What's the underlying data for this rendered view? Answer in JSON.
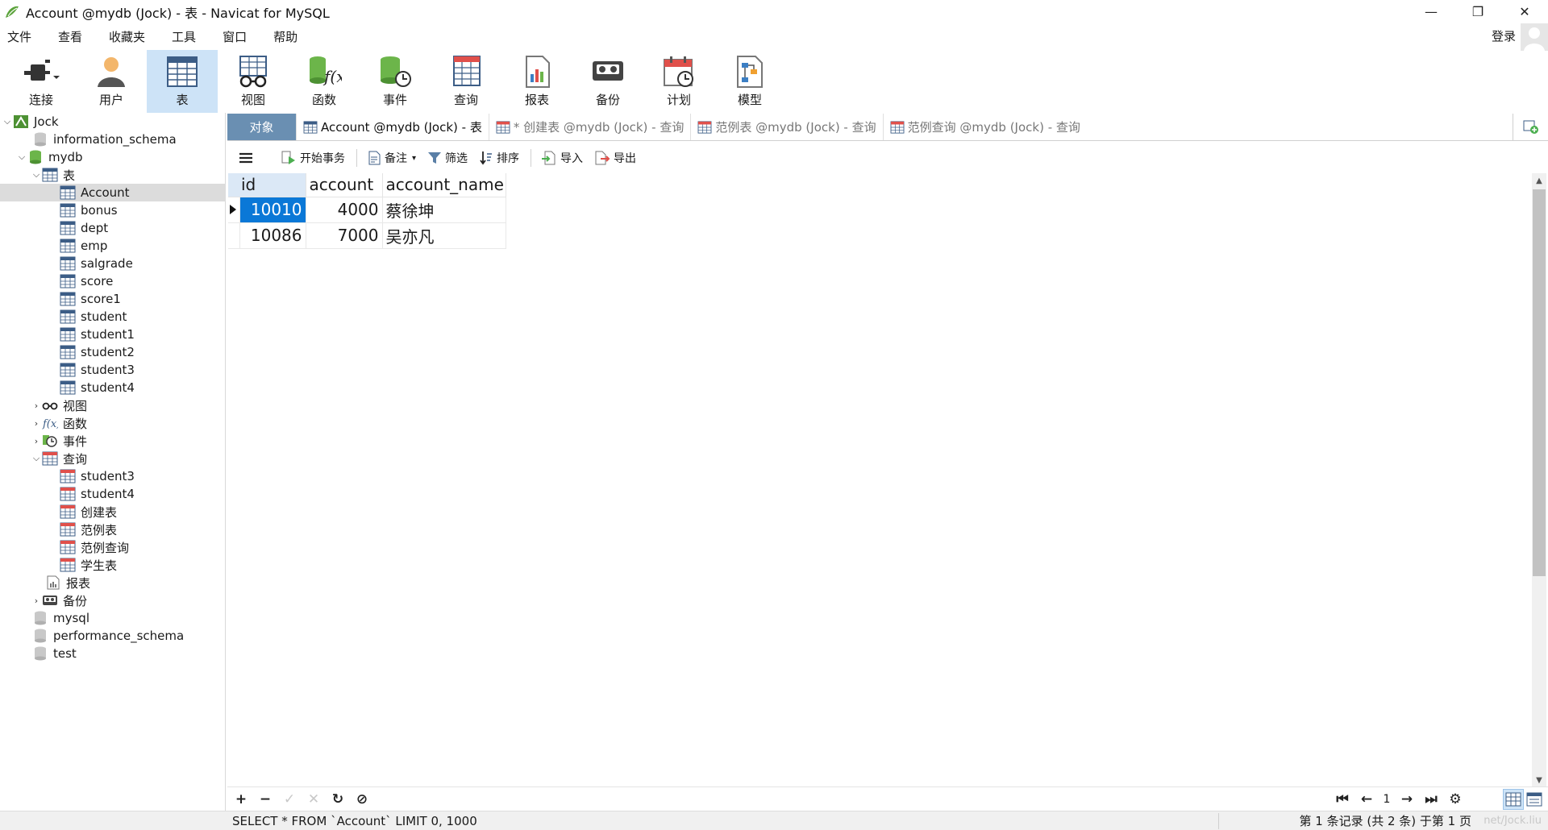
{
  "window": {
    "title": "Account @mydb (Jock) - 表 - Navicat for MySQL",
    "min": "—",
    "restore": "❐",
    "close": "✕"
  },
  "menu": [
    "文件",
    "查看",
    "收藏夹",
    "工具",
    "窗口",
    "帮助"
  ],
  "login": "登录",
  "toolbar": {
    "connect": "连接",
    "user": "用户",
    "table": "表",
    "view": "视图",
    "function": "函数",
    "event": "事件",
    "query": "查询",
    "report": "报表",
    "backup": "备份",
    "schedule": "计划",
    "model": "模型"
  },
  "tree": {
    "conn": "Jock",
    "db_info": "information_schema",
    "db_mydb": "mydb",
    "folder_tables": "表",
    "tables": [
      "Account",
      "bonus",
      "dept",
      "emp",
      "salgrade",
      "score",
      "score1",
      "student",
      "student1",
      "student2",
      "student3",
      "student4"
    ],
    "folder_views": "视图",
    "folder_funcs": "函数",
    "folder_events": "事件",
    "folder_queries": "查询",
    "queries": [
      "student3",
      "student4",
      "创建表",
      "范例表",
      "范例查询",
      "学生表"
    ],
    "folder_reports": "报表",
    "folder_backups": "备份",
    "db_mysql": "mysql",
    "db_perf": "performance_schema",
    "db_test": "test"
  },
  "tabs": {
    "objects": "对象",
    "t1": "Account @mydb (Jock) - 表",
    "t2": "* 创建表 @mydb (Jock) - 查询",
    "t3": "范例表 @mydb (Jock) - 查询",
    "t4": "范例查询 @mydb (Jock) - 查询"
  },
  "subtool": {
    "begin": "开始事务",
    "memo": "备注",
    "filter": "筛选",
    "sort": "排序",
    "import": "导入",
    "export": "导出"
  },
  "grid": {
    "columns": [
      "id",
      "account",
      "account_name"
    ],
    "rows": [
      {
        "id": "10010",
        "account": "4000",
        "account_name": "蔡徐坤"
      },
      {
        "id": "10086",
        "account": "7000",
        "account_name": "吴亦凡"
      }
    ]
  },
  "bottom": {
    "page": "1"
  },
  "status": {
    "sql": "SELECT * FROM `Account` LIMIT 0, 1000",
    "records": "第 1 条记录 (共 2 条) 于第 1 页",
    "watermark": "net/Jock.liu"
  }
}
